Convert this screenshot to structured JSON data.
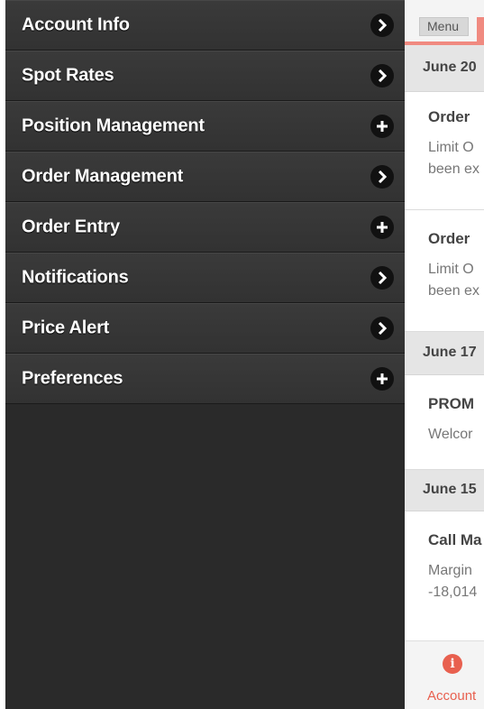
{
  "sidebar": {
    "items": [
      {
        "label": "Account Info",
        "icon": "chevron-right-icon"
      },
      {
        "label": "Spot Rates",
        "icon": "chevron-right-icon"
      },
      {
        "label": "Position Management",
        "icon": "plus-icon"
      },
      {
        "label": "Order Management",
        "icon": "chevron-right-icon"
      },
      {
        "label": "Order Entry",
        "icon": "plus-icon"
      },
      {
        "label": "Notifications",
        "icon": "chevron-right-icon"
      },
      {
        "label": "Price Alert",
        "icon": "chevron-right-icon"
      },
      {
        "label": "Preferences",
        "icon": "plus-icon"
      }
    ]
  },
  "main": {
    "menu_button": "Menu",
    "date1": "June 20",
    "note1_title": "Order",
    "note1_body_1": "Limit O",
    "note1_body_2": "been ex",
    "note2_title": "Order",
    "note2_body_1": "Limit O",
    "note2_body_2": "been ex",
    "date2": "June 17",
    "note3_title": "PROM",
    "note3_body_1": "Welcor",
    "date3": "June 15",
    "note4_title": "Call Ma",
    "note4_body_1": "Margin",
    "note4_body_2": "-18,014"
  },
  "bottom_tab": {
    "label": "Account",
    "icon": "info-icon",
    "icon_glyph": "i"
  },
  "colors": {
    "sidebar_bg": "#2a2a2a",
    "accent": "#e8604f"
  }
}
